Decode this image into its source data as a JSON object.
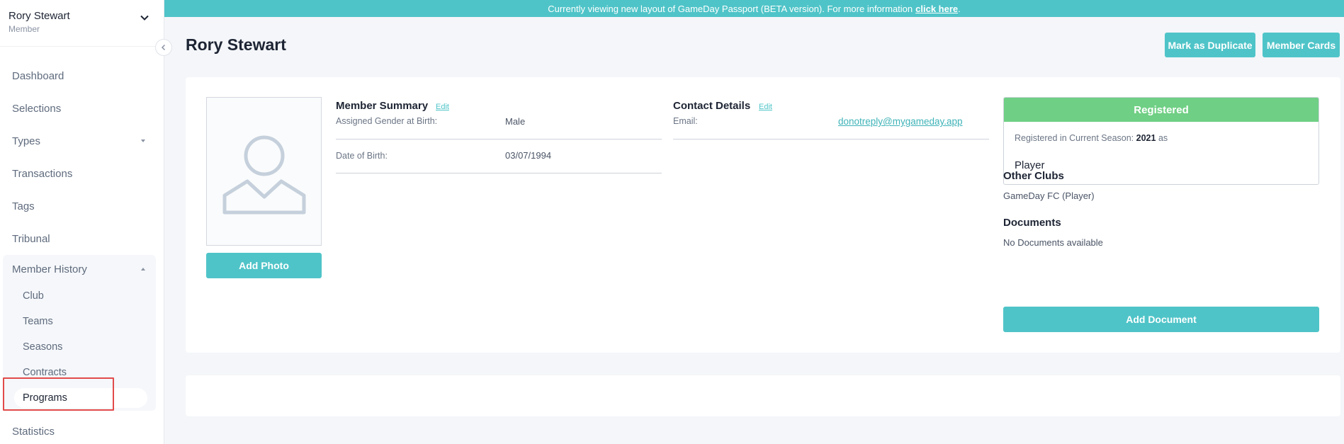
{
  "sidebar": {
    "user_name": "Rory Stewart",
    "user_role": "Member",
    "items": [
      {
        "label": "Dashboard"
      },
      {
        "label": "Selections"
      },
      {
        "label": "Types"
      },
      {
        "label": "Transactions"
      },
      {
        "label": "Tags"
      },
      {
        "label": "Tribunal"
      }
    ],
    "history": {
      "label": "Member History",
      "sub_items": [
        {
          "label": "Club"
        },
        {
          "label": "Teams"
        },
        {
          "label": "Seasons"
        },
        {
          "label": "Contracts"
        },
        {
          "label": "Programs"
        }
      ],
      "active": "Programs"
    },
    "statistics_label": "Statistics"
  },
  "banner": {
    "text": "Currently viewing new layout of GameDay Passport (BETA version). For more information",
    "link": "click here",
    "suffix": "."
  },
  "header": {
    "title": "Rory Stewart",
    "mark_duplicate": "Mark as Duplicate",
    "member_cards": "Member Cards"
  },
  "photo": {
    "add_label": "Add Photo"
  },
  "member_summary": {
    "title": "Member Summary",
    "edit": "Edit",
    "fields": [
      {
        "label": "Assigned Gender at Birth:",
        "value": "Male"
      },
      {
        "label": "Date of Birth:",
        "value": "03/07/1994"
      }
    ]
  },
  "contact": {
    "title": "Contact Details",
    "edit": "Edit",
    "email_label": "Email:",
    "email_value": "donotreply@mygameday.app"
  },
  "registration": {
    "status": "Registered",
    "line_prefix": "Registered in Current Season:",
    "season": "2021",
    "line_suffix": "as",
    "role": "Player"
  },
  "other_clubs": {
    "title": "Other Clubs",
    "text": "GameDay FC (Player)"
  },
  "documents": {
    "title": "Documents",
    "empty": "No Documents available",
    "add_label": "Add Document"
  },
  "colors": {
    "accent": "#4fc4c8",
    "registered": "#6fcf84",
    "highlight": "#e24b4b"
  }
}
